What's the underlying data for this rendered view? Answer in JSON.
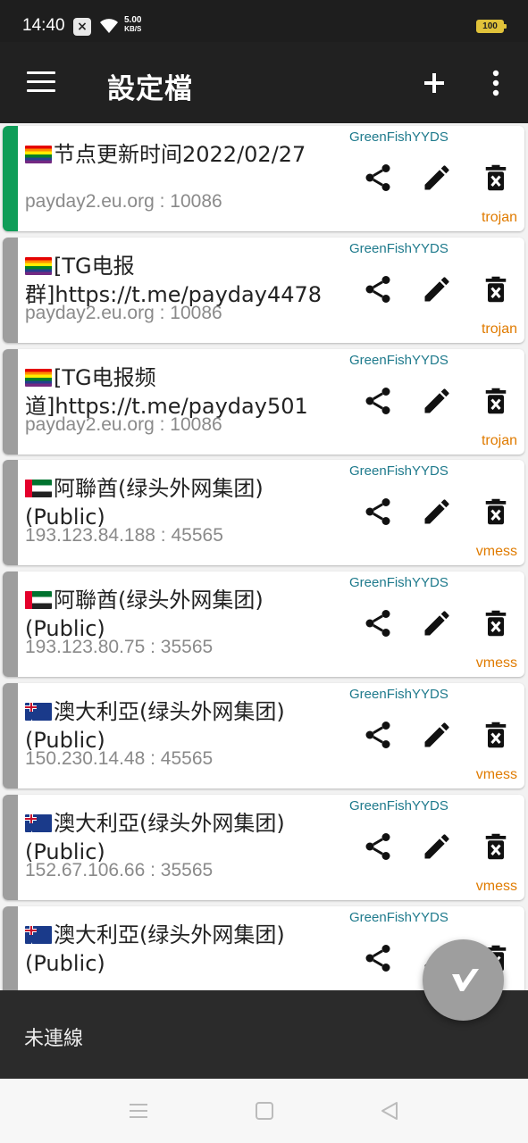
{
  "status_bar": {
    "time": "14:40",
    "notification_icon": "x-box-icon",
    "speed_value": "5.00",
    "speed_unit": "KB/S",
    "battery": "100"
  },
  "app_bar": {
    "title": "設定檔",
    "icons": [
      "menu-icon",
      "add-icon",
      "more-vert-icon"
    ]
  },
  "profiles": [
    {
      "flag": "rainbow",
      "name": "节点更新时间2022/02/27",
      "address": "payday2.eu.org : 10086",
      "subscription": "GreenFishYYDS",
      "type": "trojan",
      "selected": true
    },
    {
      "flag": "rainbow",
      "name": "[TG电报群]https://t.me/payday4478",
      "address": "payday2.eu.org : 10086",
      "subscription": "GreenFishYYDS",
      "type": "trojan",
      "selected": false
    },
    {
      "flag": "rainbow",
      "name": "[TG电报频道]https://t.me/payday501",
      "address": "payday2.eu.org : 10086",
      "subscription": "GreenFishYYDS",
      "type": "trojan",
      "selected": false
    },
    {
      "flag": "uae",
      "name": "阿聯酋(绿头外网集团)(Public)",
      "address": "193.123.84.188 : 45565",
      "subscription": "GreenFishYYDS",
      "type": "vmess",
      "selected": false
    },
    {
      "flag": "uae",
      "name": "阿聯酋(绿头外网集团)(Public)",
      "address": "193.123.80.75 : 35565",
      "subscription": "GreenFishYYDS",
      "type": "vmess",
      "selected": false
    },
    {
      "flag": "au",
      "name": "澳大利亞(绿头外网集团)(Public)",
      "address": "150.230.14.48 : 45565",
      "subscription": "GreenFishYYDS",
      "type": "vmess",
      "selected": false
    },
    {
      "flag": "au",
      "name": "澳大利亞(绿头外网集团)(Public)",
      "address": "152.67.106.66 : 35565",
      "subscription": "GreenFishYYDS",
      "type": "vmess",
      "selected": false
    },
    {
      "flag": "au",
      "name": "澳大利亞(绿头外网集团)(Public)",
      "address": "",
      "subscription": "GreenFishYYDS",
      "type": "",
      "selected": false
    }
  ],
  "row_actions": [
    "share-icon",
    "edit-icon",
    "delete-icon"
  ],
  "fab": {
    "icon": "v-logo-icon"
  },
  "bottom_bar": {
    "status": "未連線"
  },
  "nav_bar": {
    "icons": [
      "recents-icon",
      "home-icon",
      "back-icon"
    ]
  },
  "colors": {
    "app_bar": "#212121",
    "selected_indicator": "#0f9d58",
    "unselected_indicator": "#9e9e9e",
    "subscription_text": "#1e7a8c",
    "type_text": "#e07b00",
    "fab": "#9e9e9e"
  }
}
